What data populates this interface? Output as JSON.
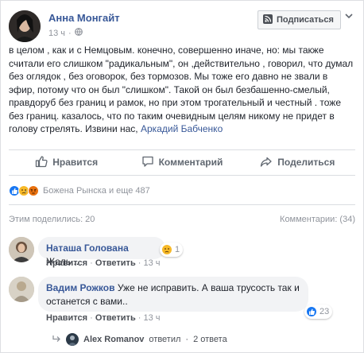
{
  "post": {
    "author": "Анна Монгайт",
    "time": "13 ч",
    "subscribe_label": "Подписаться",
    "text": "в целом , как и с Немцовым. конечно, совершенно иначе, но: мы также считали его слишком \"радикальным\", он ,действительно , говорил, что думал без оглядок , без оговорок, без тормозов. Мы тоже его давно не звали в эфир, потому что он был \"слишком\". Такой он был безбашенно-смелый, правдоруб без границ и рамок, но при этом трогательный и честный . тоже без границ. казалось, что по таким очевидным целям никому не придет в голову стрелять. Извини нас,",
    "mention": "Аркадий Бабченко"
  },
  "actions": {
    "like": "Нравится",
    "comment": "Комментарий",
    "share": "Поделиться"
  },
  "reactions": {
    "summary": "Божена Рынска и еще 487",
    "colors": {
      "like": "#1877f2",
      "sad": "#f7b928",
      "angry": "#e9710f"
    }
  },
  "stats": {
    "shares": "Этим поделились: 20",
    "comments": "Комментарии: (34)"
  },
  "comments": [
    {
      "name": "Наташа Голована",
      "text": "Жаль...",
      "like": "Нравится",
      "reply": "Ответить",
      "time": "13 ч",
      "reaction_count": "1"
    },
    {
      "name": "Вадим Рожков",
      "text": "Уже не исправить. А ваша трусость так и останется с вами..",
      "like": "Нравится",
      "reply": "Ответить",
      "time": "13 ч",
      "reaction_count": "23"
    }
  ],
  "reply_summary": {
    "name": "Alex Romanov",
    "action": "ответил",
    "count": "2 ответа"
  },
  "icons": {
    "globe": "globe-icon",
    "more": "more-options-icon",
    "like": "thumbs-up-icon",
    "comment": "comment-icon",
    "share": "share-icon",
    "reply_arrow": "reply-arrow-icon"
  }
}
